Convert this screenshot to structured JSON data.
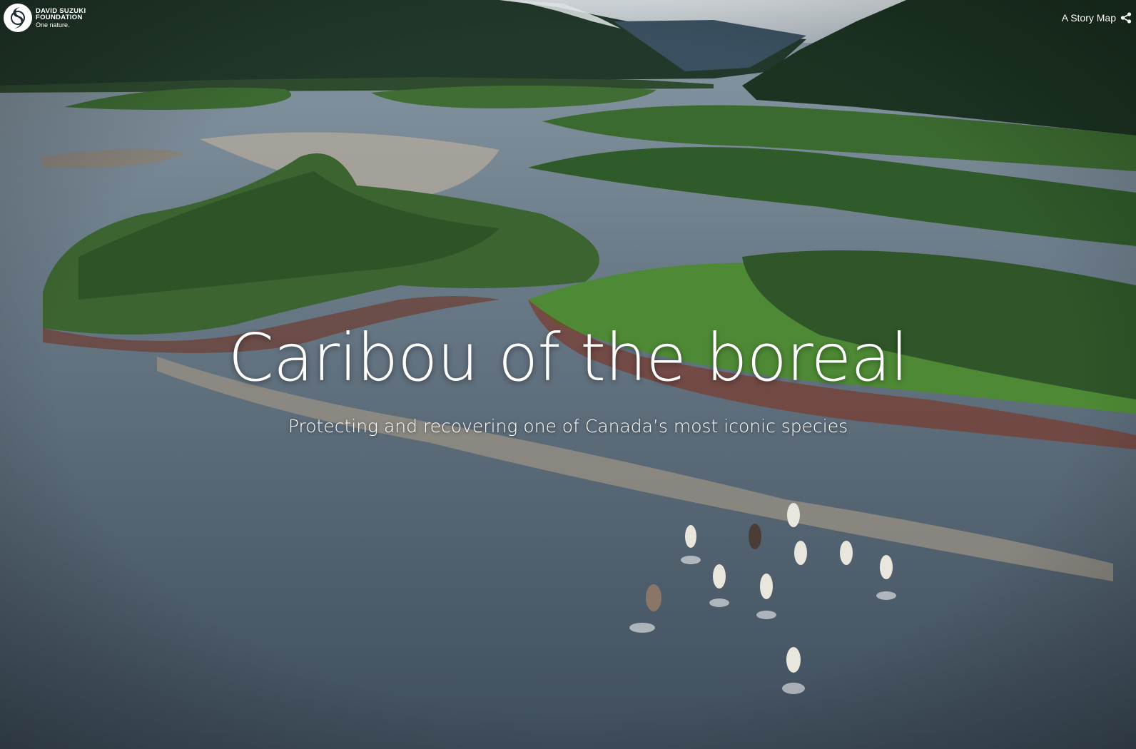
{
  "brand": {
    "line1": "DAVID SUZUKI",
    "line2": "FOUNDATION",
    "tagline": "One nature."
  },
  "header": {
    "story_map_label": "A Story Map",
    "share_icon": "share-icon"
  },
  "hero": {
    "title": "Caribou of the boreal",
    "subtitle": "Protecting and recovering one of Canada’s most iconic species",
    "background": "aerial photo of a river delta with caribou running through shallow water"
  },
  "colors": {
    "text": "#ffffff",
    "water": "#56687a",
    "forest": "#1f3a26",
    "grass": "#4e8a35"
  }
}
